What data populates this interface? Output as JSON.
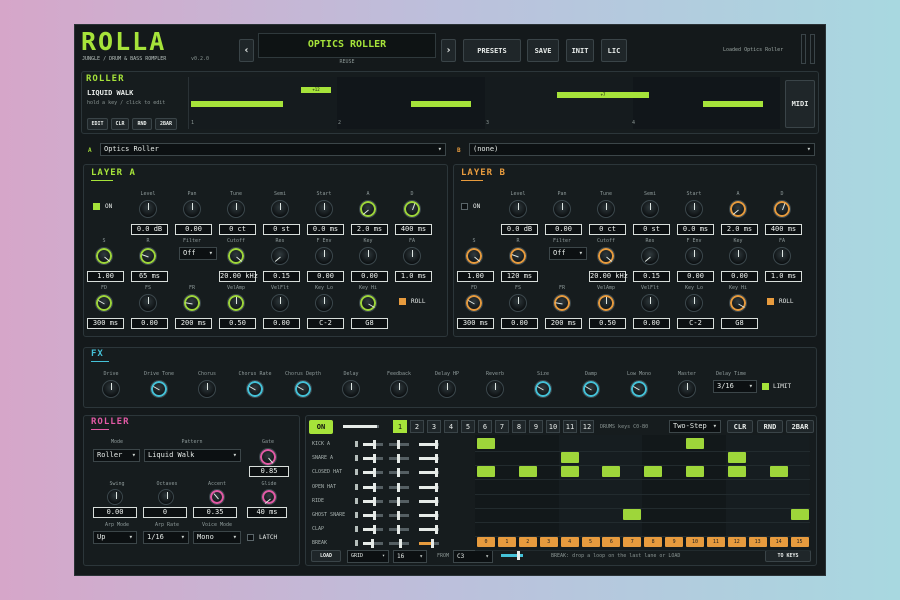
{
  "header": {
    "logo": "ROLLA",
    "subtitle": "JUNGLE / DRUM & BASS ROMPLER",
    "version": "v0.2.0",
    "preset_name": "OPTICS ROLLER",
    "preset_sub": "REUSE",
    "prev": "‹",
    "next": "›",
    "buttons": [
      "PRESETS",
      "SAVE",
      "INIT",
      "LIC"
    ],
    "status": "Loaded Optics Roller"
  },
  "roller_top": {
    "title": "ROLLER",
    "pattern": "LIQUID WALK",
    "hint": "hold a key / click to edit",
    "buttons": [
      "EDIT",
      "CLR",
      "RND",
      "2BAR"
    ],
    "beats": [
      "1",
      "2",
      "3",
      "4"
    ],
    "tags": [
      "+12",
      "+7"
    ],
    "midi": "MIDI"
  },
  "layer_select": {
    "a_letter": "A",
    "a_value": "Optics Roller",
    "b_letter": "B",
    "b_value": "(none)"
  },
  "layer_a": {
    "title": "LAYER A",
    "on": "ON",
    "roll": "ROLL",
    "row1": [
      {
        "l": "Level",
        "v": "0.0 dB"
      },
      {
        "l": "Pan",
        "v": "0.00"
      },
      {
        "l": "Tune",
        "v": "0 ct"
      },
      {
        "l": "Semi",
        "v": "0 st"
      },
      {
        "l": "Start",
        "v": "0.0 ms"
      },
      {
        "l": "A",
        "v": "2.0 ms"
      },
      {
        "l": "D",
        "v": "400 ms"
      }
    ],
    "row2": [
      {
        "l": "S",
        "v": "1.00"
      },
      {
        "l": "R",
        "v": "65 ms"
      },
      {
        "l": "Filter",
        "v": "Off"
      },
      {
        "l": "Cutoff",
        "v": "20.00 kHz"
      },
      {
        "l": "Res",
        "v": "0.15"
      },
      {
        "l": "F Env",
        "v": "0.00"
      },
      {
        "l": "Key",
        "v": "0.00"
      },
      {
        "l": "FA",
        "v": "1.0 ms"
      }
    ],
    "row3": [
      {
        "l": "FD",
        "v": "300 ms"
      },
      {
        "l": "FS",
        "v": "0.00"
      },
      {
        "l": "FR",
        "v": "200 ms"
      },
      {
        "l": "VelAmp",
        "v": "0.50"
      },
      {
        "l": "VelFlt",
        "v": "0.00"
      },
      {
        "l": "Key Lo",
        "v": "C-2"
      },
      {
        "l": "Key Hi",
        "v": "G8"
      }
    ]
  },
  "layer_b": {
    "title": "LAYER B",
    "on": "ON",
    "roll": "ROLL",
    "row1": [
      {
        "l": "Level",
        "v": "0.0 dB"
      },
      {
        "l": "Pan",
        "v": "0.00"
      },
      {
        "l": "Tune",
        "v": "0 ct"
      },
      {
        "l": "Semi",
        "v": "0 st"
      },
      {
        "l": "Start",
        "v": "0.0 ms"
      },
      {
        "l": "A",
        "v": "2.0 ms"
      },
      {
        "l": "D",
        "v": "400 ms"
      }
    ],
    "row2": [
      {
        "l": "S",
        "v": "1.00"
      },
      {
        "l": "R",
        "v": "120 ms"
      },
      {
        "l": "Filter",
        "v": "Off"
      },
      {
        "l": "Cutoff",
        "v": "20.00 kHz"
      },
      {
        "l": "Res",
        "v": "0.15"
      },
      {
        "l": "F Env",
        "v": "0.00"
      },
      {
        "l": "Key",
        "v": "0.00"
      },
      {
        "l": "FA",
        "v": "1.0 ms"
      }
    ],
    "row3": [
      {
        "l": "FD",
        "v": "300 ms"
      },
      {
        "l": "FS",
        "v": "0.00"
      },
      {
        "l": "FR",
        "v": "200 ms"
      },
      {
        "l": "VelAmp",
        "v": "0.50"
      },
      {
        "l": "VelFlt",
        "v": "0.00"
      },
      {
        "l": "Key Lo",
        "v": "C-2"
      },
      {
        "l": "Key Hi",
        "v": "G8"
      }
    ]
  },
  "fx": {
    "title": "FX",
    "knobs": [
      "Drive",
      "Drive Tone",
      "Chorus",
      "Chorus Rate",
      "Chorus Depth",
      "Delay",
      "Feedback",
      "Delay HP",
      "Reverb",
      "Size",
      "Damp",
      "Low Mono",
      "Master"
    ],
    "delay_time_label": "Delay Time",
    "delay_time": "3/16",
    "limit": "LIMIT"
  },
  "roller_bottom": {
    "title": "ROLLER",
    "mode_l": "Mode",
    "mode": "Roller",
    "pattern_l": "Pattern",
    "pattern": "Liquid Walk",
    "gate_l": "Gate",
    "gate": "0.85",
    "swing_l": "Swing",
    "swing": "0.00",
    "octaves_l": "Octaves",
    "octaves": "0",
    "accent_l": "Accent",
    "accent": "0.35",
    "glide_l": "Glide",
    "glide": "40 ms",
    "arpmode_l": "Arp Mode",
    "arpmode": "Up",
    "arprate_l": "Arp Rate",
    "arprate": "1/16",
    "voicemode_l": "Voice Mode",
    "voicemode": "Mono",
    "latch": "LATCH"
  },
  "seq": {
    "on": "ON",
    "steps": [
      "1",
      "2",
      "3",
      "4",
      "5",
      "6",
      "7",
      "8",
      "9",
      "10",
      "11",
      "12"
    ],
    "info": "DRUMS keys C0-B0",
    "mode": "Two-Step",
    "clr": "CLR",
    "rnd": "RND",
    "bar": "2BAR",
    "rows": [
      "KICK A",
      "SNARE A",
      "CLOSED HAT",
      "OPEN HAT",
      "RIDE",
      "GHOST SNARE",
      "CLAP",
      "BREAK"
    ],
    "slices": [
      "0",
      "1",
      "2",
      "3",
      "4",
      "5",
      "6",
      "7",
      "8",
      "9",
      "10",
      "11",
      "12",
      "13",
      "14",
      "15"
    ],
    "load": "LOAD",
    "grid_l": "GRID",
    "grid": "16",
    "from_l": "FROM",
    "from": "C3",
    "hint": "BREAK: drop a loop on the last lane or LOAD",
    "to_keys": "TO KEYS"
  },
  "colors": {
    "accent_green": "#a6e33a",
    "accent_orange": "#e79b3e",
    "accent_pink": "#e25aa5",
    "accent_cyan": "#45c2d8"
  }
}
